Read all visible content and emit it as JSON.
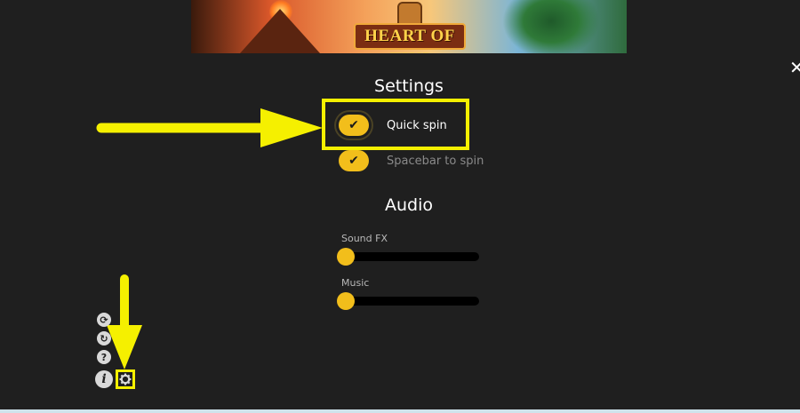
{
  "banner": {
    "logo_text": "HEART OF TIKI"
  },
  "close_label": "✕",
  "settings": {
    "heading": "Settings",
    "options": [
      {
        "label": "Quick spin",
        "checked": true,
        "check_glyph": "✔"
      },
      {
        "label": "Spacebar to spin",
        "checked": true,
        "check_glyph": "✔"
      }
    ]
  },
  "audio": {
    "heading": "Audio",
    "sliders": [
      {
        "label": "Sound FX",
        "value": 0
      },
      {
        "label": "Music",
        "value": 0
      }
    ]
  },
  "side_icons": {
    "autoplay_glyph": "⟳",
    "replay_glyph": "↻",
    "help_glyph": "?",
    "info_glyph": "i"
  },
  "colors": {
    "background": "#1f1f1f",
    "accent": "#f2be1b",
    "annotation": "#f5f000"
  }
}
